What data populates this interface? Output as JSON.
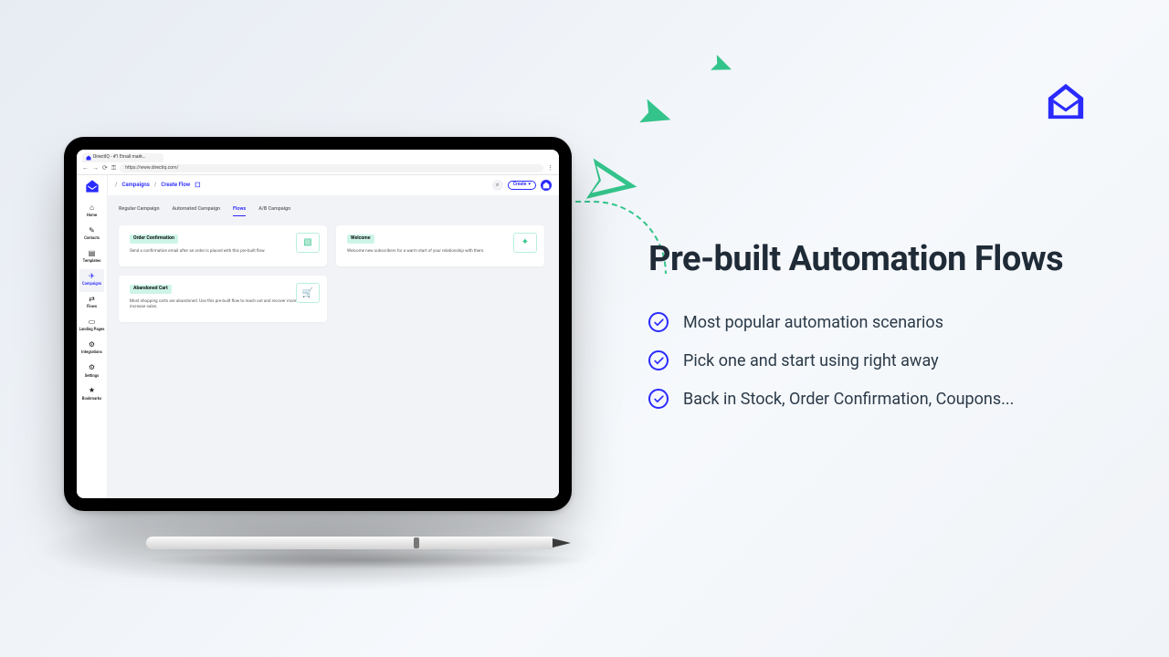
{
  "promo": {
    "headline": "Pre-built Automation Flows",
    "bullets": [
      "Most popular automation scenarios",
      "Pick one and start using right away",
      "Back in Stock, Order Confirmation, Coupons..."
    ]
  },
  "browser": {
    "tab_title": "DirectIQ - #1 Email mark…",
    "url": "https://www.directiq.com/"
  },
  "app": {
    "breadcrumbs": [
      "Campaigns",
      "Create Flow"
    ],
    "create_button": "Create",
    "sidebar": [
      {
        "icon": "home-icon",
        "glyph": "⌂",
        "label": "Home"
      },
      {
        "icon": "contacts-icon",
        "glyph": "✎",
        "label": "Contacts"
      },
      {
        "icon": "templates-icon",
        "glyph": "▤",
        "label": "Templates"
      },
      {
        "icon": "campaigns-icon",
        "glyph": "✈",
        "label": "Campaigns"
      },
      {
        "icon": "flows-icon",
        "glyph": "⇄",
        "label": "Flows"
      },
      {
        "icon": "landing-pages-icon",
        "glyph": "▭",
        "label": "Landing Pages"
      },
      {
        "icon": "integrations-icon",
        "glyph": "⚙",
        "label": "Integrations"
      },
      {
        "icon": "settings-icon",
        "glyph": "⚙",
        "label": "Settings"
      },
      {
        "icon": "bookmarks-icon",
        "glyph": "★",
        "label": "Bookmarks"
      }
    ],
    "tabs": [
      {
        "label": "Regular Campaign"
      },
      {
        "label": "Automated Campaign"
      },
      {
        "label": "Flows",
        "active": true
      },
      {
        "label": "A/B Campaign"
      }
    ],
    "cards": [
      {
        "title": "Order Confirmation",
        "desc": "Send a confirmation email after an order is placed with this pre-built flow.",
        "illus": "▧"
      },
      {
        "title": "Welcome",
        "desc": "Welcome new subscribers for a warm start of your relationship with them.",
        "illus": "✦"
      },
      {
        "title": "Abandoned Cart",
        "desc": "Most shopping carts are abandoned. Use this pre-built flow to reach out and recover more to increase sales.",
        "illus": "🛒"
      }
    ]
  }
}
